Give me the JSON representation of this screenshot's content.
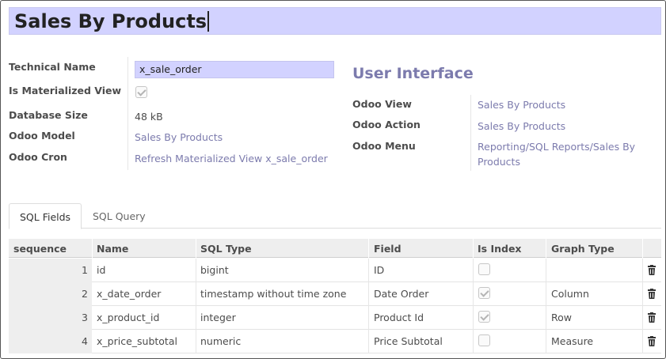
{
  "title": "Sales By Products",
  "left_fields": {
    "technical_name_label": "Technical Name",
    "technical_name_value": "x_sale_order",
    "materialized_label": "Is Materialized View",
    "materialized_checked": true,
    "db_size_label": "Database Size",
    "db_size_value": "48 kB",
    "model_label": "Odoo Model",
    "model_value": "Sales By Products",
    "cron_label": "Odoo Cron",
    "cron_value": "Refresh Materialized View x_sale_order"
  },
  "ui_section": {
    "heading": "User Interface",
    "view_label": "Odoo View",
    "view_value": "Sales By Products",
    "action_label": "Odoo Action",
    "action_value": "Sales By Products",
    "menu_label": "Odoo Menu",
    "menu_value_line1": "Reporting/SQL Reports/Sales By",
    "menu_value_line2": "Products"
  },
  "tabs": [
    {
      "label": "SQL Fields",
      "active": true
    },
    {
      "label": "SQL Query",
      "active": false
    }
  ],
  "table": {
    "headers": [
      "sequence",
      "Name",
      "SQL Type",
      "Field",
      "Is Index",
      "Graph Type"
    ],
    "rows": [
      {
        "sequence": "1",
        "name": "id",
        "sql_type": "bigint",
        "field": "ID",
        "is_index": false,
        "graph_type": ""
      },
      {
        "sequence": "2",
        "name": "x_date_order",
        "sql_type": "timestamp without time zone",
        "field": "Date Order",
        "is_index": true,
        "graph_type": "Column"
      },
      {
        "sequence": "3",
        "name": "x_product_id",
        "sql_type": "integer",
        "field": "Product Id",
        "is_index": true,
        "graph_type": "Row"
      },
      {
        "sequence": "4",
        "name": "x_price_subtotal",
        "sql_type": "numeric",
        "field": "Price Subtotal",
        "is_index": false,
        "graph_type": "Measure"
      }
    ]
  },
  "icons": {
    "delete": "trash-icon",
    "checkbox": "checkbox"
  },
  "colors": {
    "accent": "#7c7bad",
    "input_bg": "#d2d2ff",
    "header_bg": "#eeeeee"
  }
}
